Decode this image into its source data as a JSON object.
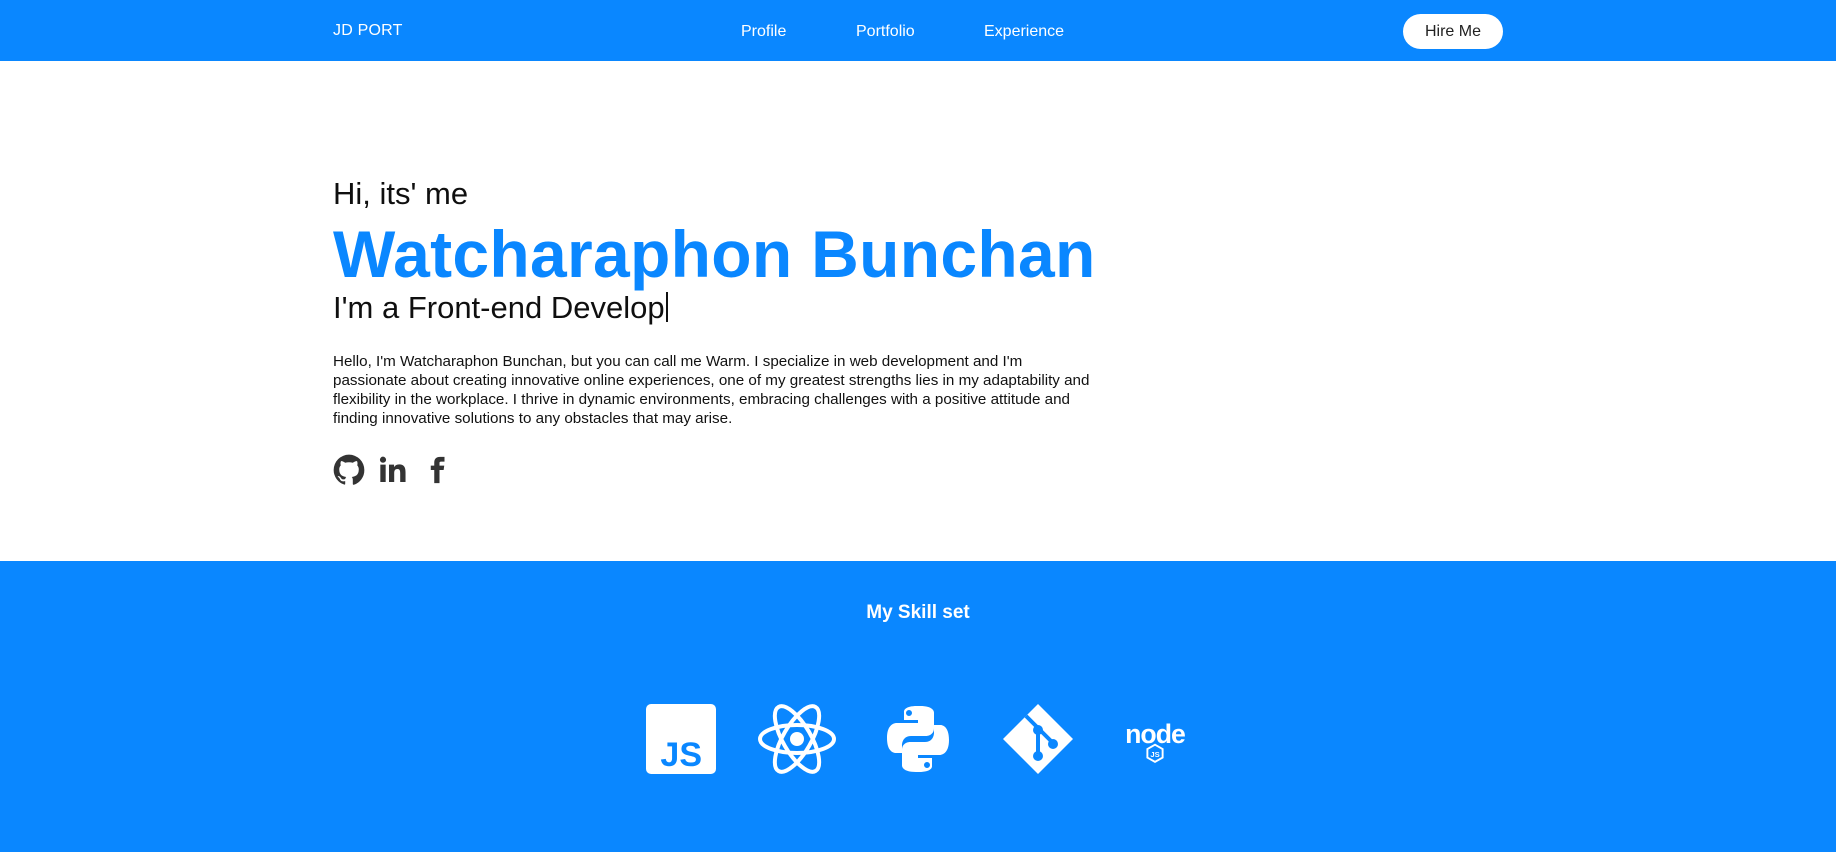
{
  "nav": {
    "brand": "JD PORT",
    "links": [
      "Profile",
      "Portfolio",
      "Experience"
    ],
    "cta": "Hire Me"
  },
  "hero": {
    "greeting": "Hi, its' me",
    "name": "Watcharaphon Bunchan",
    "role": "I'm a Front-end Develop",
    "bio": "Hello, I'm Watcharaphon Bunchan, but you can call me Warm. I specialize in web development and I'm passionate about creating innovative online experiences, one of my greatest strengths lies in my adaptability and flexibility in the workplace. I thrive in dynamic environments, embracing challenges with a positive attitude and finding innovative solutions to any obstacles that may arise.",
    "socials": [
      "github-icon",
      "linkedin-icon",
      "facebook-icon"
    ]
  },
  "skills": {
    "title": "My Skill set",
    "icons": [
      "javascript-icon",
      "react-icon",
      "python-icon",
      "git-icon",
      "nodejs-icon"
    ]
  },
  "colors": {
    "primary": "#0a87ff",
    "text": "#111111",
    "social_icon": "#333333",
    "background": "#ffffff"
  }
}
